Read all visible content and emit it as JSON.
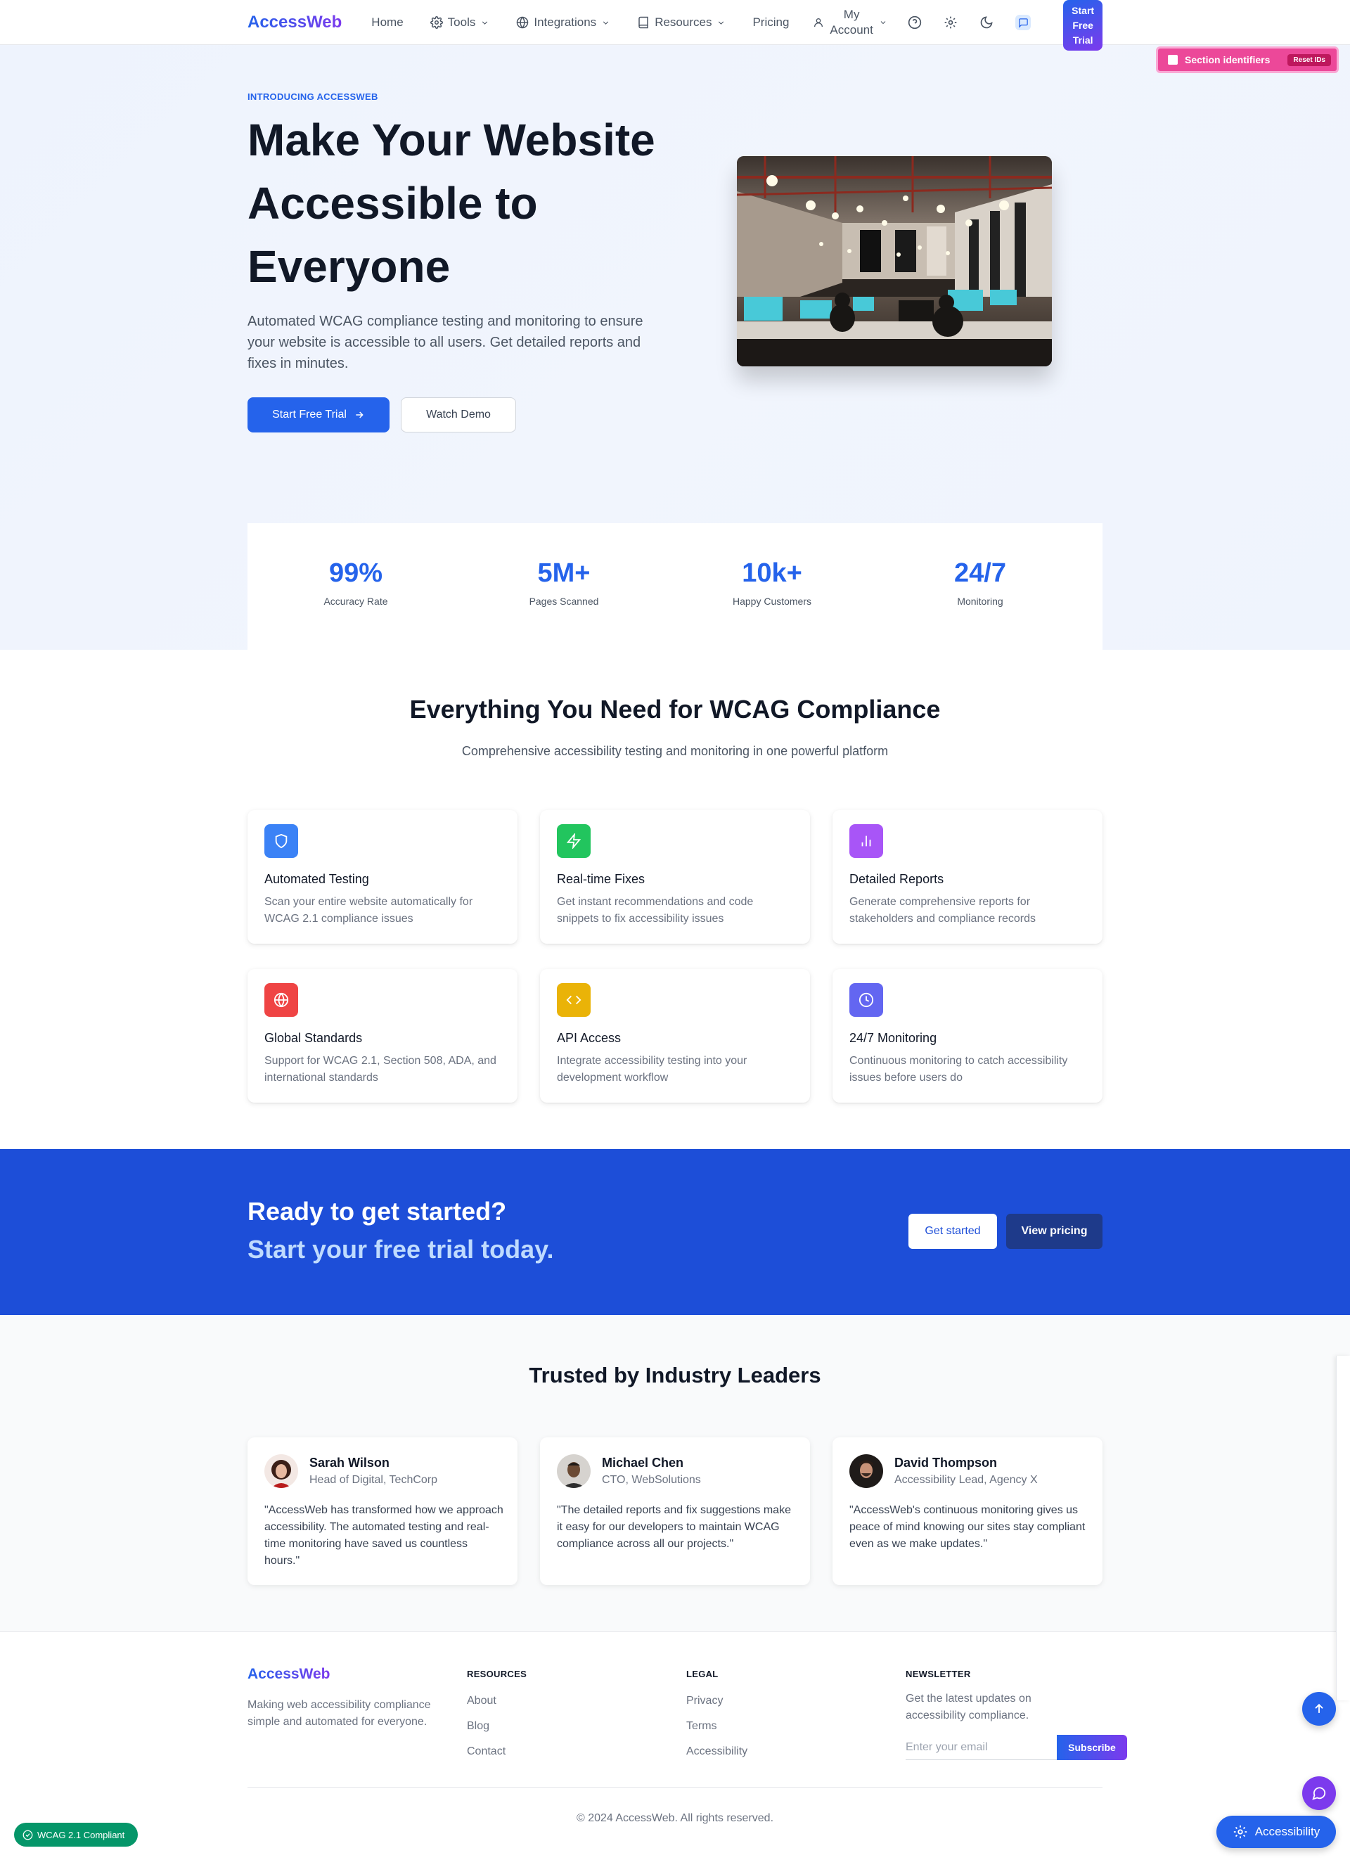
{
  "nav": {
    "logo": "AccessWeb",
    "links": [
      {
        "label": "Home"
      },
      {
        "label": "Tools"
      },
      {
        "label": "Integrations"
      },
      {
        "label": "Resources"
      },
      {
        "label": "Pricing"
      }
    ],
    "account_line1": "My",
    "account_line2": "Account",
    "trial_button": "Start Free Trial"
  },
  "section_ids": {
    "label": "Section identifiers",
    "reset": "Reset IDs"
  },
  "hero": {
    "kicker": "INTRODUCING ACCESSWEB",
    "title": "Make Your Website Accessible to Everyone",
    "subtitle": "Automated WCAG compliance testing and monitoring to ensure your website is accessible to all users. Get detailed reports and fixes in minutes.",
    "primary_button": "Start Free Trial",
    "secondary_button": "Watch Demo"
  },
  "stats": [
    {
      "value": "99%",
      "label": "Accuracy Rate"
    },
    {
      "value": "5M+",
      "label": "Pages Scanned"
    },
    {
      "value": "10k+",
      "label": "Happy Customers"
    },
    {
      "value": "24/7",
      "label": "Monitoring"
    }
  ],
  "features": {
    "title": "Everything You Need for WCAG Compliance",
    "subtitle": "Comprehensive accessibility testing and monitoring in one powerful platform",
    "items": [
      {
        "title": "Automated Testing",
        "desc": "Scan your entire website automatically for WCAG 2.1 compliance issues",
        "icon": "shield-icon",
        "color": "#3b82f6"
      },
      {
        "title": "Real-time Fixes",
        "desc": "Get instant recommendations and code snippets to fix accessibility issues",
        "icon": "bolt-icon",
        "color": "#22c55e"
      },
      {
        "title": "Detailed Reports",
        "desc": "Generate comprehensive reports for stakeholders and compliance records",
        "icon": "bar-chart-icon",
        "color": "#a855f7"
      },
      {
        "title": "Global Standards",
        "desc": "Support for WCAG 2.1, Section 508, ADA, and international standards",
        "icon": "globe-icon",
        "color": "#ef4444"
      },
      {
        "title": "API Access",
        "desc": "Integrate accessibility testing into your development workflow",
        "icon": "code-icon",
        "color": "#eab308"
      },
      {
        "title": "24/7 Monitoring",
        "desc": "Continuous monitoring to catch accessibility issues before users do",
        "icon": "clock-icon",
        "color": "#6366f1"
      }
    ]
  },
  "cta": {
    "line1": "Ready to get started?",
    "line2": "Start your free trial today.",
    "button1": "Get started",
    "button2": "View pricing"
  },
  "testimonials": {
    "title": "Trusted by Industry Leaders",
    "items": [
      {
        "name": "Sarah Wilson",
        "role": "Head of Digital, TechCorp",
        "quote": "\"AccessWeb has transformed how we approach accessibility. The automated testing and real-time monitoring have saved us countless hours.\""
      },
      {
        "name": "Michael Chen",
        "role": "CTO, WebSolutions",
        "quote": "\"The detailed reports and fix suggestions make it easy for our developers to maintain WCAG compliance across all our projects.\""
      },
      {
        "name": "David Thompson",
        "role": "Accessibility Lead, Agency X",
        "quote": "\"AccessWeb's continuous monitoring gives us peace of mind knowing our sites stay compliant even as we make updates.\""
      }
    ]
  },
  "footer": {
    "logo": "AccessWeb",
    "desc": "Making web accessibility compliance simple and automated for everyone.",
    "resources": {
      "heading": "RESOURCES",
      "links": [
        "About",
        "Blog",
        "Contact"
      ]
    },
    "legal": {
      "heading": "LEGAL",
      "links": [
        "Privacy",
        "Terms",
        "Accessibility"
      ]
    },
    "newsletter": {
      "heading": "NEWSLETTER",
      "text": "Get the latest updates on accessibility compliance.",
      "placeholder": "Enter your email",
      "button": "Subscribe"
    },
    "copyright": "© 2024 AccessWeb. All rights reserved."
  },
  "widgets": {
    "wcag_badge": "WCAG 2.1 Compliant",
    "accessibility_button": "Accessibility"
  }
}
